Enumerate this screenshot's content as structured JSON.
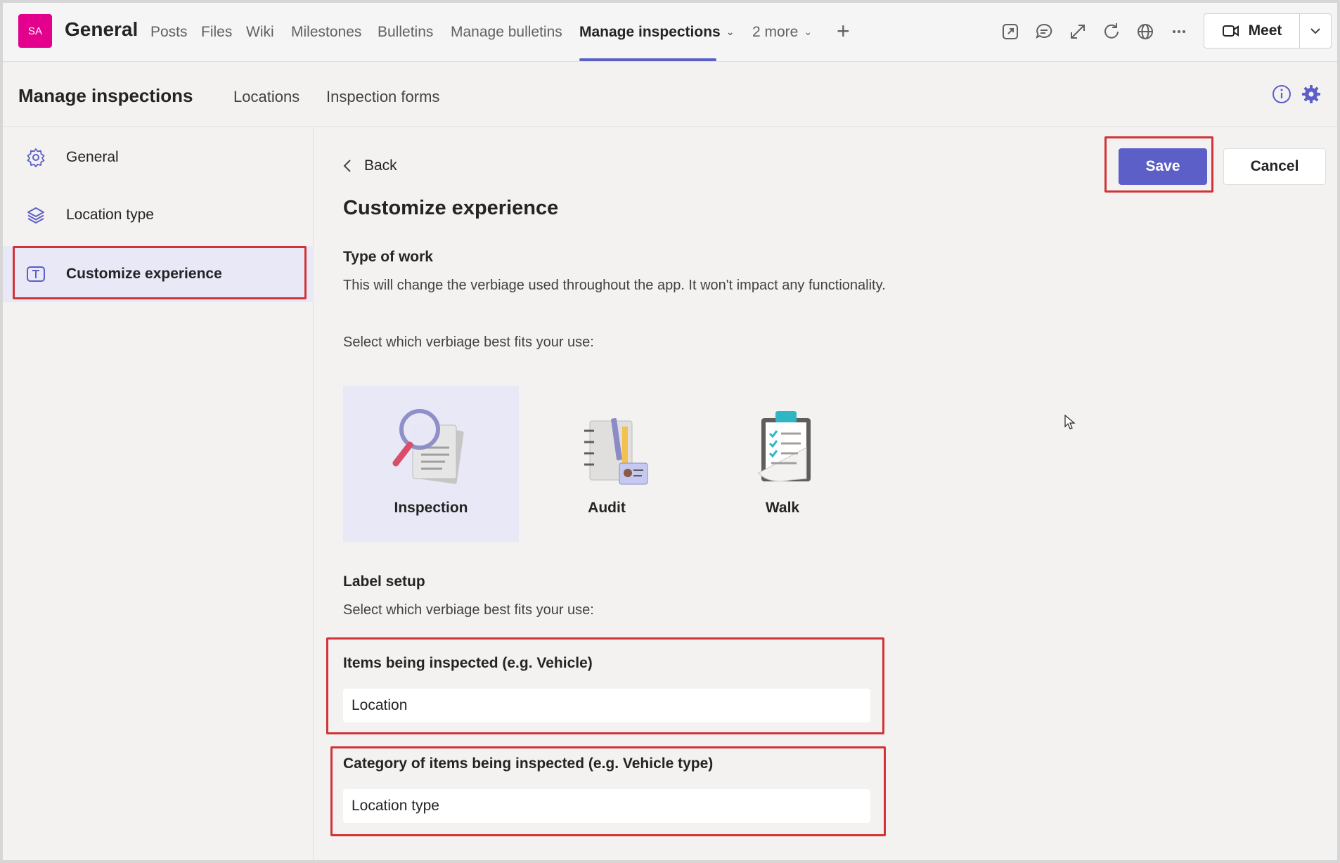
{
  "topbar": {
    "avatar_initials": "SA",
    "channel": "General",
    "tabs": [
      {
        "label": "Posts"
      },
      {
        "label": "Files"
      },
      {
        "label": "Wiki"
      },
      {
        "label": "Milestones"
      },
      {
        "label": "Bulletins"
      },
      {
        "label": "Manage bulletins"
      },
      {
        "label": "Manage inspections"
      },
      {
        "label": "2 more"
      }
    ],
    "meet_label": "Meet",
    "accent_color": "#5b5fc7",
    "avatar_color": "#e3008c"
  },
  "subheader": {
    "title": "Manage inspections",
    "tabs": [
      "Locations",
      "Inspection forms"
    ]
  },
  "sidebar": {
    "items": [
      {
        "label": "General",
        "icon": "gear-icon"
      },
      {
        "label": "Location type",
        "icon": "layers-icon"
      },
      {
        "label": "Customize experience",
        "icon": "text-box-icon"
      }
    ]
  },
  "main": {
    "back_label": "Back",
    "title": "Customize experience",
    "save_label": "Save",
    "cancel_label": "Cancel",
    "type_of_work": {
      "heading": "Type of work",
      "description": "This will change the verbiage used throughout the app. It won't impact any functionality.",
      "prompt": "Select which verbiage best fits your use:",
      "options": [
        {
          "label": "Inspection",
          "selected": true
        },
        {
          "label": "Audit",
          "selected": false
        },
        {
          "label": "Walk",
          "selected": false
        }
      ]
    },
    "label_setup": {
      "heading": "Label setup",
      "prompt": "Select which verbiage best fits your use:",
      "fields": [
        {
          "label": "Items being inspected (e.g. Vehicle)",
          "value": "Location"
        },
        {
          "label": "Category of items being inspected (e.g. Vehicle type)",
          "value": "Location type"
        }
      ]
    }
  }
}
